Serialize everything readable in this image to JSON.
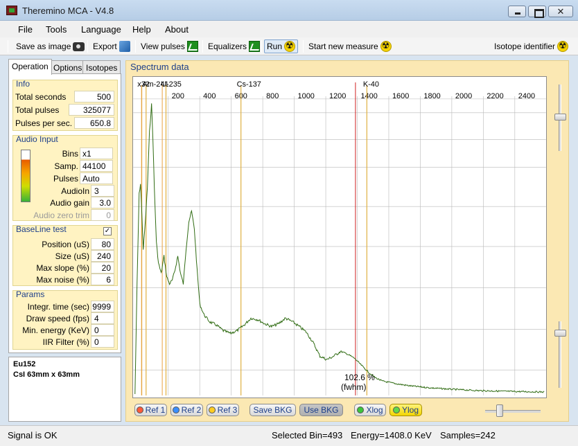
{
  "window": {
    "title": "Theremino MCA - V4.8"
  },
  "menu": [
    "File",
    "Tools",
    "Language",
    "Help",
    "About"
  ],
  "toolbar": {
    "save_image": "Save as image",
    "export": "Export",
    "view_pulses": "View pulses",
    "equalizers": "Equalizers",
    "run": "Run",
    "new_measure": "Start new measure",
    "isotope_identifier": "Isotope identifier"
  },
  "tabs": [
    "Operation",
    "Options",
    "Isotopes"
  ],
  "info": {
    "title": "Info",
    "rows": [
      {
        "label": "Total seconds",
        "value": "500"
      },
      {
        "label": "Total pulses",
        "value": "325077"
      },
      {
        "label": "Pulses per sec.",
        "value": "650.8"
      }
    ]
  },
  "audio": {
    "title": "Audio Input",
    "level": 0.82,
    "rows": [
      {
        "label": "Bins",
        "value": "x1"
      },
      {
        "label": "Samp.",
        "value": "44100"
      },
      {
        "label": "Pulses",
        "value": "Auto"
      },
      {
        "label": "AudioIn",
        "value": "3"
      },
      {
        "label": "Audio gain",
        "value": "3.0"
      },
      {
        "label": "Audio zero trim",
        "value": "0"
      }
    ]
  },
  "baseline": {
    "title": "BaseLine test",
    "checked": "✓",
    "rows": [
      {
        "label": "Position (uS)",
        "value": "80"
      },
      {
        "label": "Size (uS)",
        "value": "240"
      },
      {
        "label": "Max slope (%)",
        "value": "20"
      },
      {
        "label": "Max noise (%)",
        "value": "6"
      }
    ]
  },
  "params": {
    "title": "Params",
    "rows": [
      {
        "label": "Integr. time (sec)",
        "value": "9999"
      },
      {
        "label": "Draw speed (fps)",
        "value": "4"
      },
      {
        "label": "Min. energy (KeV)",
        "value": "0"
      },
      {
        "label": "IIR Filter (%)",
        "value": "0"
      }
    ]
  },
  "notes": {
    "line1": "Eu152",
    "line2": "CsI 63mm x 63mm"
  },
  "spectrum": {
    "title": "Spectrum data",
    "ticks": [
      "200",
      "400",
      "600",
      "800",
      "1000",
      "1200",
      "1400",
      "1600",
      "1800",
      "2000",
      "2200",
      "2400"
    ],
    "isotope_labels": [
      "x32",
      "Am-241",
      "U-235",
      "Cs-137",
      "K-40"
    ],
    "fwhm_value": "102.6 %",
    "fwhm_unit": "(fwhm)",
    "colors": {
      "trace": "#2f6b12",
      "grid": "#b8b8b8",
      "marker": "#e0b040",
      "selected": "#d02020"
    }
  },
  "buttons": {
    "ref1": "Ref 1",
    "ref2": "Ref 2",
    "ref3": "Ref 3",
    "save_bkg": "Save BKG",
    "use_bkg": "Use BKG",
    "xlog": "Xlog",
    "ylog": "Ylog"
  },
  "status": {
    "signal": "Signal is OK",
    "selected_bin": "Selected Bin=493",
    "energy": "Energy=1408.0 KeV",
    "samples": "Samples=242"
  }
}
